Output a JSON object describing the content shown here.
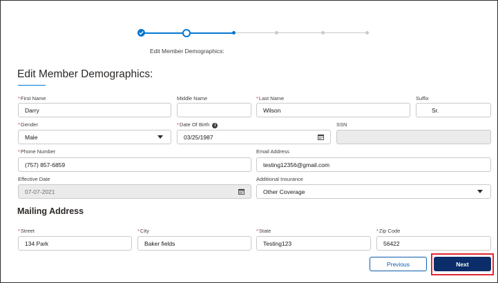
{
  "progress": {
    "caption": "Edit Member Demographics:",
    "steps": [
      "complete",
      "active",
      "current-small",
      "incomplete",
      "incomplete",
      "incomplete"
    ]
  },
  "form": {
    "heading": "Edit Member Demographics:",
    "first_name": {
      "label": "First Name",
      "value": "Darry"
    },
    "middle_name": {
      "label": "Middle Name",
      "value": ""
    },
    "last_name": {
      "label": "Last Name",
      "value": "Wilson"
    },
    "suffix": {
      "label": "Suffix",
      "value": "Sr."
    },
    "gender": {
      "label": "Gender",
      "value": "Male"
    },
    "dob": {
      "label": "Date Of Birth",
      "value": "03/25/1987"
    },
    "ssn": {
      "label": "SSN",
      "value": ""
    },
    "phone": {
      "label": "Phone Number",
      "value": "(757) 857-6859"
    },
    "email": {
      "label": "Email Address",
      "value": "testing12356@gmail.com"
    },
    "effective_date": {
      "label": "Effective Date",
      "value": "07-07-2021"
    },
    "insurance": {
      "label": "Additional Insurance",
      "value": "Other Coverage"
    }
  },
  "mailing": {
    "heading": "Mailing Address",
    "street": {
      "label": "Street",
      "value": "134 Park"
    },
    "city": {
      "label": "City",
      "value": "Baker fields"
    },
    "state": {
      "label": "State",
      "value": "Testing123"
    },
    "zip": {
      "label": "Zip Code",
      "value": "56422"
    }
  },
  "buttons": {
    "previous": "Previous",
    "next": "Next"
  },
  "colors": {
    "brand": "#0176d3",
    "next_bg": "#0b2e6a",
    "highlight": "#e0262f",
    "required": "#c23934"
  }
}
